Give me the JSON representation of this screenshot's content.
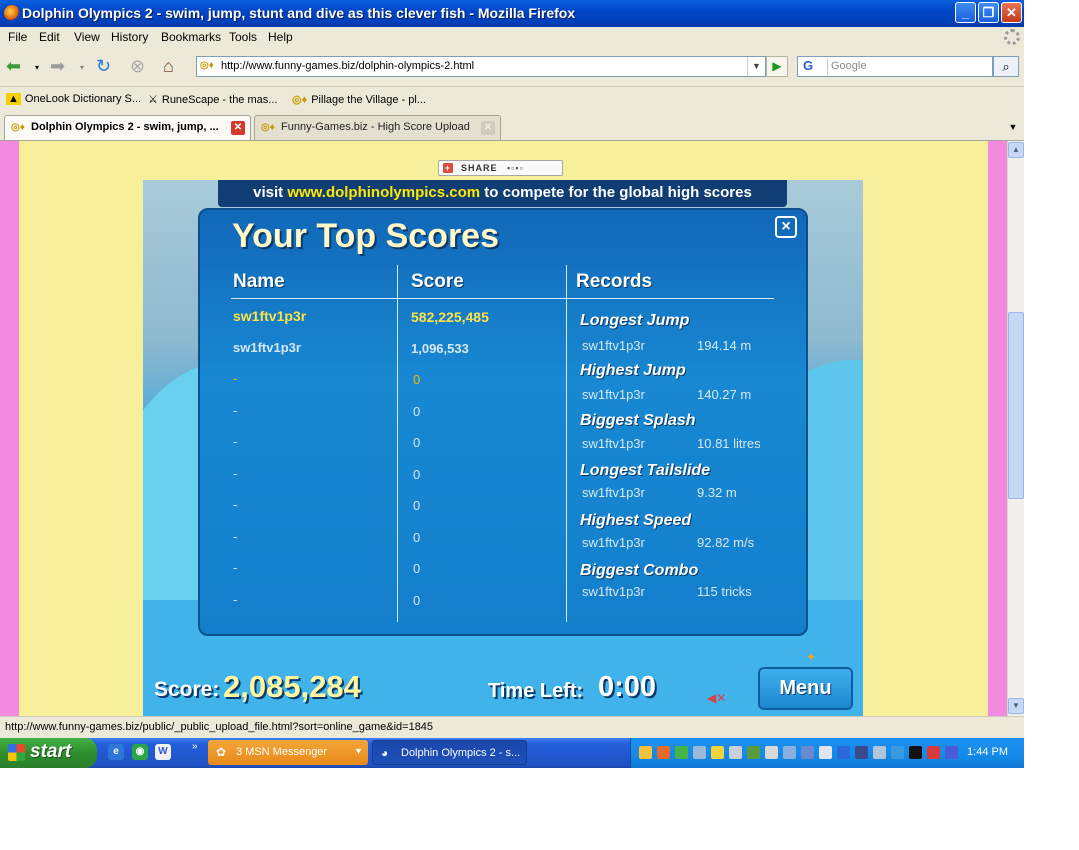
{
  "window": {
    "title": "Dolphin Olympics 2 - swim, jump, stunt and dive as this clever fish - Mozilla Firefox"
  },
  "menu": [
    "File",
    "Edit",
    "View",
    "History",
    "Bookmarks",
    "Tools",
    "Help"
  ],
  "nav": {
    "url": "http://www.funny-games.biz/dolphin-olympics-2.html",
    "search_engine": "G",
    "search_placeholder": "Google"
  },
  "bookmarks": [
    "OneLook Dictionary S...",
    "RuneScape - the mas...",
    "Pillage the Village - pl..."
  ],
  "tabs": [
    {
      "title": "Dolphin Olympics 2 - swim, jump, ...",
      "active": true
    },
    {
      "title": "Funny-Games.biz - High Score Upload",
      "active": false
    }
  ],
  "share": {
    "label": "SHARE"
  },
  "game": {
    "visit_prefix": "visit",
    "visit_site": "www.dolphinolympics.com",
    "visit_suffix": "to compete for the global high scores",
    "panel_title": "Your Top Scores",
    "close_label": "×",
    "headers": {
      "name": "Name",
      "score": "Score",
      "records": "Records"
    },
    "scores": [
      {
        "name": "sw1ftv1p3r",
        "score": "582,225,485"
      },
      {
        "name": "sw1ftv1p3r",
        "score": "1,096,533"
      },
      {
        "name": "-",
        "score": "0"
      },
      {
        "name": "-",
        "score": "0"
      },
      {
        "name": "-",
        "score": "0"
      },
      {
        "name": "-",
        "score": "0"
      },
      {
        "name": "-",
        "score": "0"
      },
      {
        "name": "-",
        "score": "0"
      },
      {
        "name": "-",
        "score": "0"
      },
      {
        "name": "-",
        "score": "0"
      }
    ],
    "records": [
      {
        "title": "Longest Jump",
        "holder": "sw1ftv1p3r",
        "value": "194.14 m"
      },
      {
        "title": "Highest Jump",
        "holder": "sw1ftv1p3r",
        "value": "140.27 m"
      },
      {
        "title": "Biggest Splash",
        "holder": "sw1ftv1p3r",
        "value": "10.81 litres"
      },
      {
        "title": "Longest Tailslide",
        "holder": "sw1ftv1p3r",
        "value": "9.32 m"
      },
      {
        "title": "Highest Speed",
        "holder": "sw1ftv1p3r",
        "value": "92.82 m/s"
      },
      {
        "title": "Biggest Combo",
        "holder": "sw1ftv1p3r",
        "value": "115 tricks"
      }
    ],
    "score_label": "Score:",
    "score_value": "2,085,284",
    "time_label": "Time Left:",
    "time_value": "0:00",
    "menu_button": "Menu"
  },
  "status": {
    "text": "http://www.funny-games.biz/public/_public_upload_file.html?sort=online_game&id=1845"
  },
  "taskbar": {
    "start": "start",
    "buttons": [
      {
        "label": "3 MSN Messenger"
      },
      {
        "label": "Dolphin Olympics 2 - s..."
      }
    ],
    "clock": "1:44 PM"
  },
  "colors": {
    "title_bar": "#0046c8",
    "page_bg": "#f7ef99",
    "side_strip": "#f28be0",
    "panel": "#1888d2",
    "highlight": "#ffe24a"
  }
}
